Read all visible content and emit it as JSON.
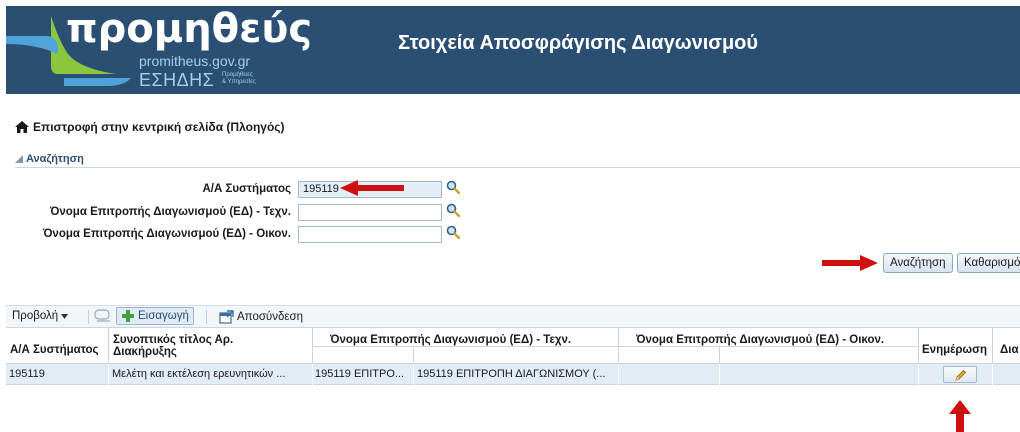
{
  "header": {
    "logo_text": "προμηθεύς",
    "logo_url": "promitheus.gov.gr",
    "logo_esidis": "ΕΣΗΔΗΣ",
    "logo_small_1": "Προμήθειες",
    "logo_small_2": "& Υπηρεσίες",
    "title": "Στοιχεία Αποσφράγισης Διαγωνισμού"
  },
  "nav": {
    "back_link": "Επιστροφή στην κεντρική σελίδα (Πλοηγός)"
  },
  "search": {
    "section_title": "Αναζήτηση",
    "fields": [
      {
        "label": "Α/Α Συστήματος",
        "value": "195119"
      },
      {
        "label": "Όνομα Επιτροπής Διαγωνισμού (ΕΔ) - Τεχν.",
        "value": ""
      },
      {
        "label": "Όνομα Επιτροπής Διαγωνισμού (ΕΔ) - Οικον.",
        "value": ""
      }
    ],
    "search_button": "Αναζήτηση",
    "clear_button": "Καθαρισμός"
  },
  "toolbar": {
    "view_label": "Προβολή",
    "insert_label": "Εισαγωγή",
    "detach_label": "Αποσύνδεση"
  },
  "table": {
    "columns": [
      "Α/Α Συστήματος",
      "Συνοπτικός τίτλος Αρ. Διακήρυξης",
      "Όνομα Επιτροπής Διαγωνισμού (ΕΔ) - Τεχν.",
      "Όνομα Επιτροπής Διαγωνισμού (ΕΔ) - Οικον.",
      "Ενημέρωση",
      "Δια"
    ],
    "rows": [
      {
        "id": "195119",
        "title": "Μελέτη και εκτέλεση ερευνητικών ...",
        "tech_code": "195119 ΕΠΙΤΡΟ...",
        "tech_name": "195119 ΕΠΙΤΡΟΠΗ ΔΙΑΓΩΝΙΣΜΟΥ (...",
        "econ": ""
      }
    ]
  },
  "colors": {
    "header_bg": "#2b4f73",
    "accent_red": "#d01010",
    "row_selected": "#e2ecf5"
  }
}
